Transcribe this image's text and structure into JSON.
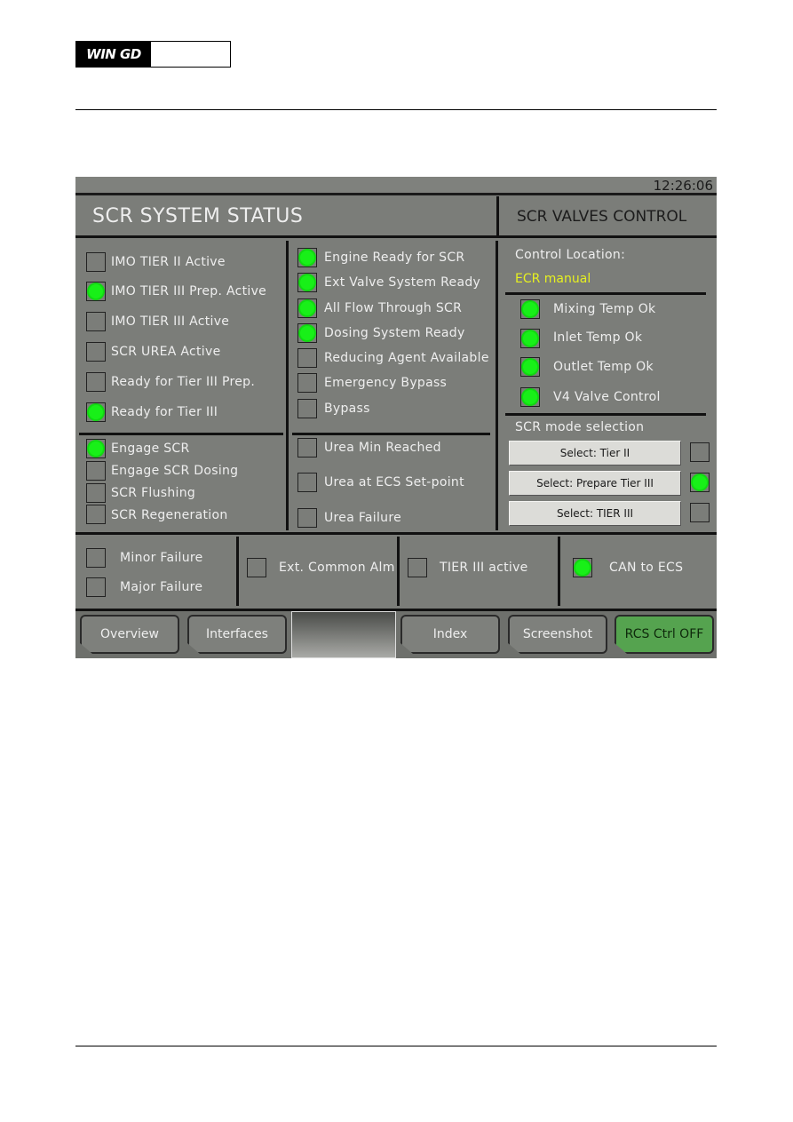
{
  "document": {
    "logo_text": "WIN GD"
  },
  "screen": {
    "clock": "12:26:06",
    "title_left": "SCR SYSTEM STATUS",
    "title_right": "SCR VALVES CONTROL",
    "colors": {
      "indicator_on": "#18f018",
      "panel_bg": "#7b7d79",
      "control_value": "#e6f020",
      "rcs_button": "#55a34f"
    },
    "status_col1_top": [
      {
        "label": "IMO TIER II Active",
        "on": false
      },
      {
        "label": "IMO TIER III Prep. Active",
        "on": true
      },
      {
        "label": "IMO TIER III Active",
        "on": false
      },
      {
        "label": "SCR UREA Active",
        "on": false
      },
      {
        "label": "Ready for Tier III Prep.",
        "on": false
      },
      {
        "label": "Ready for Tier III",
        "on": true
      }
    ],
    "status_col1_bottom": [
      {
        "label": "Engage SCR",
        "on": true
      },
      {
        "label": "Engage SCR Dosing",
        "on": false
      },
      {
        "label": "SCR Flushing",
        "on": false
      },
      {
        "label": "SCR Regeneration",
        "on": false
      }
    ],
    "status_col2_top": [
      {
        "label": "Engine Ready for SCR",
        "on": true
      },
      {
        "label": "Ext Valve System Ready",
        "on": true
      },
      {
        "label": "All Flow Through SCR",
        "on": true
      },
      {
        "label": "Dosing System Ready",
        "on": true
      },
      {
        "label": "Reducing Agent Available",
        "on": false
      },
      {
        "label": "Emergency Bypass",
        "on": false
      },
      {
        "label": "Bypass",
        "on": false
      }
    ],
    "status_col2_bottom": [
      {
        "label": "Urea Min Reached",
        "on": false
      },
      {
        "label": "Urea at ECS Set-point",
        "on": false
      },
      {
        "label": "Urea Failure",
        "on": false
      }
    ],
    "valves": {
      "control_location_label": "Control Location:",
      "control_location_value": "ECR manual",
      "items": [
        {
          "label": "Mixing Temp Ok",
          "on": true
        },
        {
          "label": "Inlet Temp Ok",
          "on": true
        },
        {
          "label": "Outlet Temp Ok",
          "on": true
        },
        {
          "label": "V4 Valve Control",
          "on": true
        }
      ],
      "mode_selection_label": "SCR mode selection",
      "modes": [
        {
          "label": "Select: Tier II",
          "on": false
        },
        {
          "label": "Select: Prepare Tier III",
          "on": true
        },
        {
          "label": "Select: TIER III",
          "on": false
        }
      ]
    },
    "alarms": [
      {
        "label": "Minor Failure",
        "on": false
      },
      {
        "label": "Major Failure",
        "on": false
      },
      {
        "label": "Ext. Common Alm",
        "on": false
      },
      {
        "label": "TIER III active",
        "on": false
      },
      {
        "label": "CAN to ECS",
        "on": true
      }
    ],
    "nav": {
      "overview": "Overview",
      "interfaces": "Interfaces",
      "index": "Index",
      "screenshot": "Screenshot",
      "rcs": "RCS Ctrl OFF"
    }
  }
}
